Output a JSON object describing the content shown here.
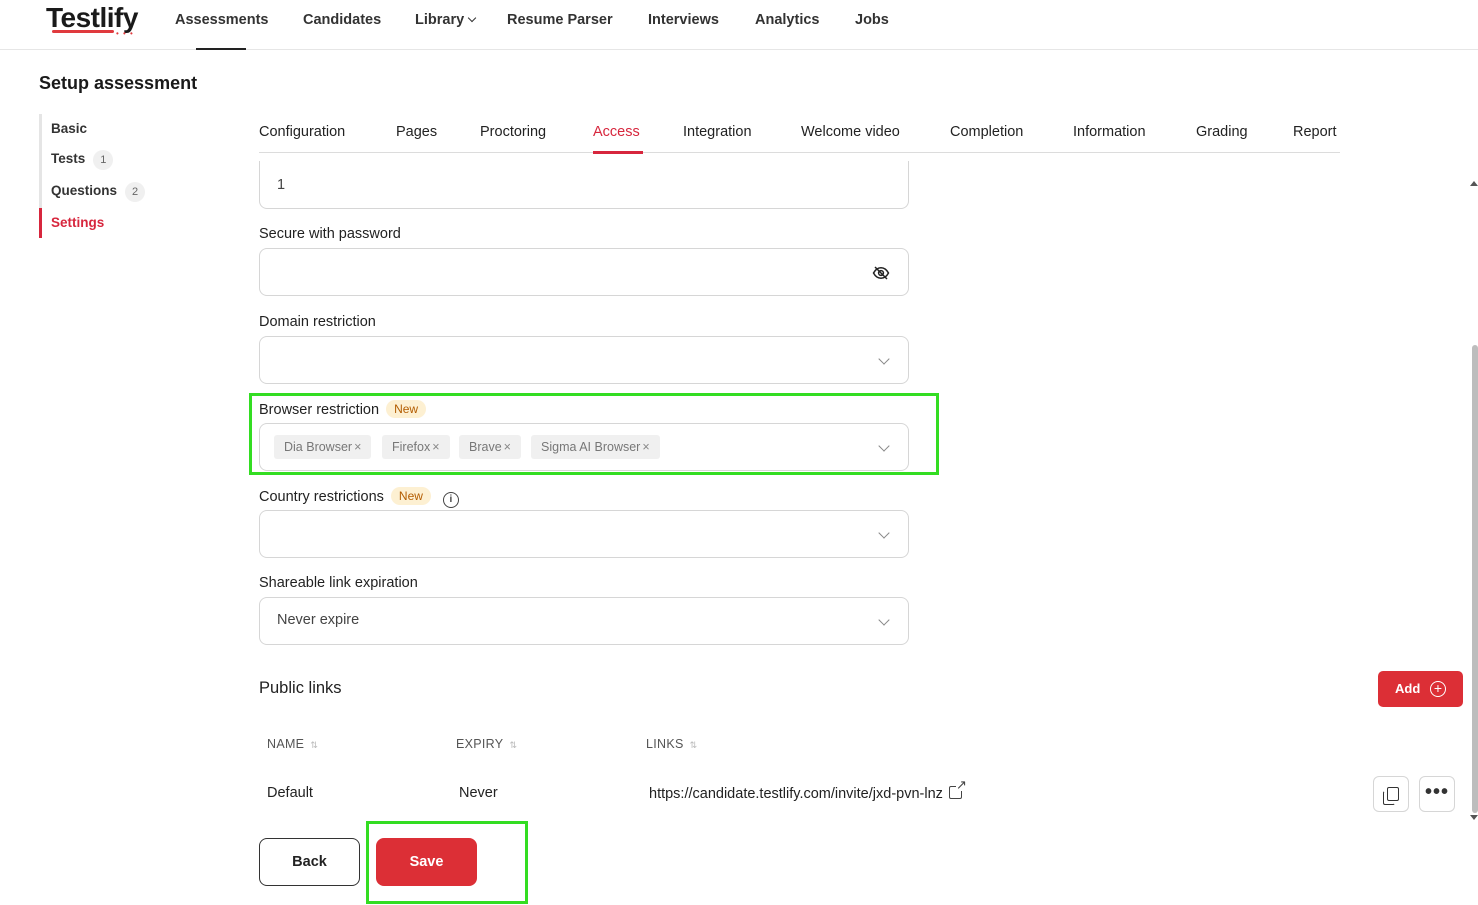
{
  "brand": {
    "logo_text": "Testlify",
    "accent": "#dc2f36",
    "highlight": "#33dd22"
  },
  "nav": {
    "items": [
      {
        "label": "Assessments"
      },
      {
        "label": "Candidates"
      },
      {
        "label": "Library"
      },
      {
        "label": "Resume Parser"
      },
      {
        "label": "Interviews"
      },
      {
        "label": "Analytics"
      },
      {
        "label": "Jobs"
      }
    ],
    "active": "Assessments"
  },
  "page": {
    "title": "Setup assessment"
  },
  "sidebar": {
    "items": [
      {
        "label": "Basic",
        "count": ""
      },
      {
        "label": "Tests",
        "count": "1"
      },
      {
        "label": "Questions",
        "count": "2"
      },
      {
        "label": "Settings",
        "count": ""
      }
    ],
    "active": "Settings"
  },
  "tabs": {
    "items": [
      {
        "label": "Configuration"
      },
      {
        "label": "Pages"
      },
      {
        "label": "Proctoring"
      },
      {
        "label": "Access"
      },
      {
        "label": "Integration"
      },
      {
        "label": "Welcome video"
      },
      {
        "label": "Completion"
      },
      {
        "label": "Information"
      },
      {
        "label": "Grading"
      },
      {
        "label": "Report"
      }
    ],
    "active": "Access"
  },
  "form": {
    "top_field": {
      "value": "1"
    },
    "password": {
      "label": "Secure with password",
      "value": "",
      "icon": "eye-off-icon"
    },
    "domain": {
      "label": "Domain restriction",
      "value": ""
    },
    "browser": {
      "label": "Browser restriction",
      "badge": "New",
      "tags": [
        "Dia Browser",
        "Firefox",
        "Brave",
        "Sigma AI Browser"
      ],
      "remove_glyph": "×"
    },
    "country": {
      "label": "Country restrictions",
      "badge": "New",
      "info_glyph": "i",
      "value": ""
    },
    "expiration": {
      "label": "Shareable link expiration",
      "value": "Never expire"
    }
  },
  "public_links": {
    "title": "Public links",
    "add_label": "Add",
    "add_glyph": "+",
    "columns": [
      "NAME",
      "EXPIRY",
      "LINKS"
    ],
    "sort_glyph": "⇅",
    "rows": [
      {
        "name": "Default",
        "expiry": "Never",
        "link": "https://candidate.testlify.com/invite/jxd-pvn-lnz"
      }
    ],
    "more_glyph": "•••"
  },
  "actions": {
    "back_label": "Back",
    "save_label": "Save"
  }
}
